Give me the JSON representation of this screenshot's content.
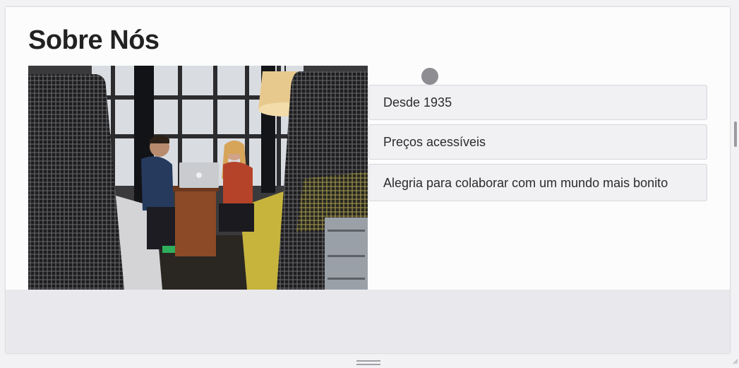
{
  "page": {
    "title": "Sobre Nós"
  },
  "photo": {
    "alt": "Duas pessoas conversando em frente a um laptop numa cabine de escritório"
  },
  "features": {
    "items": [
      "Desde 1935",
      "Preços acessíveis",
      "Alegria para colaborar com um mundo mais bonito"
    ]
  },
  "icons": {
    "cursor": "cursor-dot-icon",
    "resize": "resize-handle-icon",
    "grip": "corner-grip-icon"
  },
  "colors": {
    "background": "#fdfcfd",
    "item_background": "#f1f0f3",
    "item_border": "#d7d6da",
    "footer": "#e9e8ec",
    "text": "#222222"
  }
}
